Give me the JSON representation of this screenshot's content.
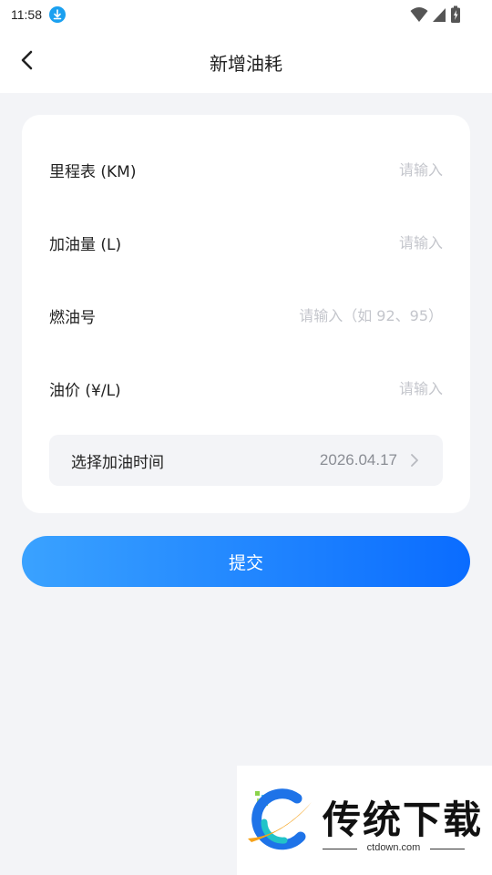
{
  "status_bar": {
    "time": "11:58",
    "icons": [
      "download-icon",
      "wifi-icon",
      "signal-icon",
      "battery-icon"
    ]
  },
  "header": {
    "title": "新增油耗",
    "back_icon": "chevron-left-icon"
  },
  "form": {
    "fields": [
      {
        "label": "里程表 (KM)",
        "placeholder": "请输入",
        "value": ""
      },
      {
        "label": "加油量 (L)",
        "placeholder": "请输入",
        "value": ""
      },
      {
        "label": "燃油号",
        "placeholder": "请输入（如 92、95）",
        "value": ""
      },
      {
        "label": "油价 (¥/L)",
        "placeholder": "请输入",
        "value": ""
      }
    ],
    "time": {
      "label": "选择加油时间",
      "value": "2026.04.17",
      "icon": "chevron-right-icon"
    }
  },
  "submit": {
    "label": "提交"
  },
  "watermark": {
    "brand": "传统下载",
    "url": "ctdown.com"
  },
  "colors": {
    "accent_start": "#3aa2ff",
    "accent_end": "#0a6cff",
    "background": "#f3f4f7",
    "placeholder": "#c4c6cc"
  }
}
